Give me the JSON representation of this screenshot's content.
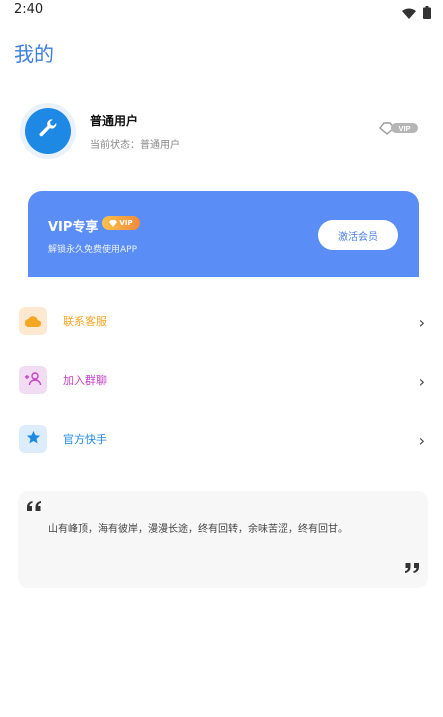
{
  "status_bar": {
    "time": "2:40"
  },
  "page": {
    "title": "我的"
  },
  "profile": {
    "name": "普通用户",
    "status": "当前状态：普通用户",
    "badge": "VIP"
  },
  "vip_card": {
    "title": "VIP专享",
    "tag": "VIP",
    "description": "解锁永久免费使用APP",
    "button_label": "激活会员"
  },
  "menu": [
    {
      "label": "联系客服",
      "color": "#f5a623",
      "icon_bg": "#fde9cf",
      "icon": "cloud-icon"
    },
    {
      "label": "加入群聊",
      "color": "#c643c8",
      "icon_bg": "#f1dcf4",
      "icon": "group-icon"
    },
    {
      "label": "官方快手",
      "color": "#1e88e5",
      "icon_bg": "#dcecfb",
      "icon": "star-icon"
    }
  ],
  "quote": {
    "text": "山有峰顶，海有彼岸，漫漫长途，终有回转，余味苦涩，终有回甘。"
  },
  "colors": {
    "accent": "#3d7fe0",
    "vip_card": "#5b8df6"
  }
}
